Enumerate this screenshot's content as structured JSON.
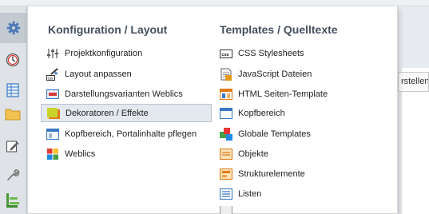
{
  "background_button": {
    "label": "rstellen"
  },
  "sidebar": {
    "items": [
      {
        "icon": "gear-icon",
        "active": true
      },
      {
        "icon": "clock-icon"
      },
      {
        "icon": "table-icon"
      },
      {
        "icon": "folder-icon"
      },
      {
        "icon": "edit-icon"
      },
      {
        "icon": "wrench-icon"
      },
      {
        "icon": "tree-icon"
      }
    ]
  },
  "menu": {
    "columns": [
      {
        "title": "Konfiguration / Layout",
        "items": [
          {
            "label": "Projektkonfiguration",
            "icon": "sliders-icon"
          },
          {
            "label": "Layout anpassen",
            "icon": "css-brush-icon"
          },
          {
            "label": "Darstellungsvarianten Weblics",
            "icon": "window-icon"
          },
          {
            "label": "Dekoratoren / Effekte",
            "icon": "decorator-icon",
            "highlighted": true
          },
          {
            "label": "Kopfbereich, Portalinhalte pflegen",
            "icon": "layout-icon"
          },
          {
            "label": "Weblics",
            "icon": "weblics-icon"
          }
        ]
      },
      {
        "title": "Templates / Quelltexte",
        "items": [
          {
            "label": "CSS Stylesheets",
            "icon": "css-file-icon"
          },
          {
            "label": "JavaScript Dateien",
            "icon": "javascript-icon"
          },
          {
            "label": "HTML Seiten-Template",
            "icon": "html-template-icon"
          },
          {
            "label": "Kopfbereich",
            "icon": "header-icon"
          },
          {
            "label": "Globale Templates",
            "icon": "global-templates-icon"
          },
          {
            "label": "Objekte",
            "icon": "objects-icon"
          },
          {
            "label": "Strukturelemente",
            "icon": "structure-icon"
          },
          {
            "label": "Listen",
            "icon": "list-icon"
          }
        ]
      }
    ]
  },
  "colors": {
    "title": "#46505f",
    "highlight_bg": "#e4e8ef",
    "highlight_border": "#b9c2cf",
    "accent_blue": "#3a78c3"
  }
}
